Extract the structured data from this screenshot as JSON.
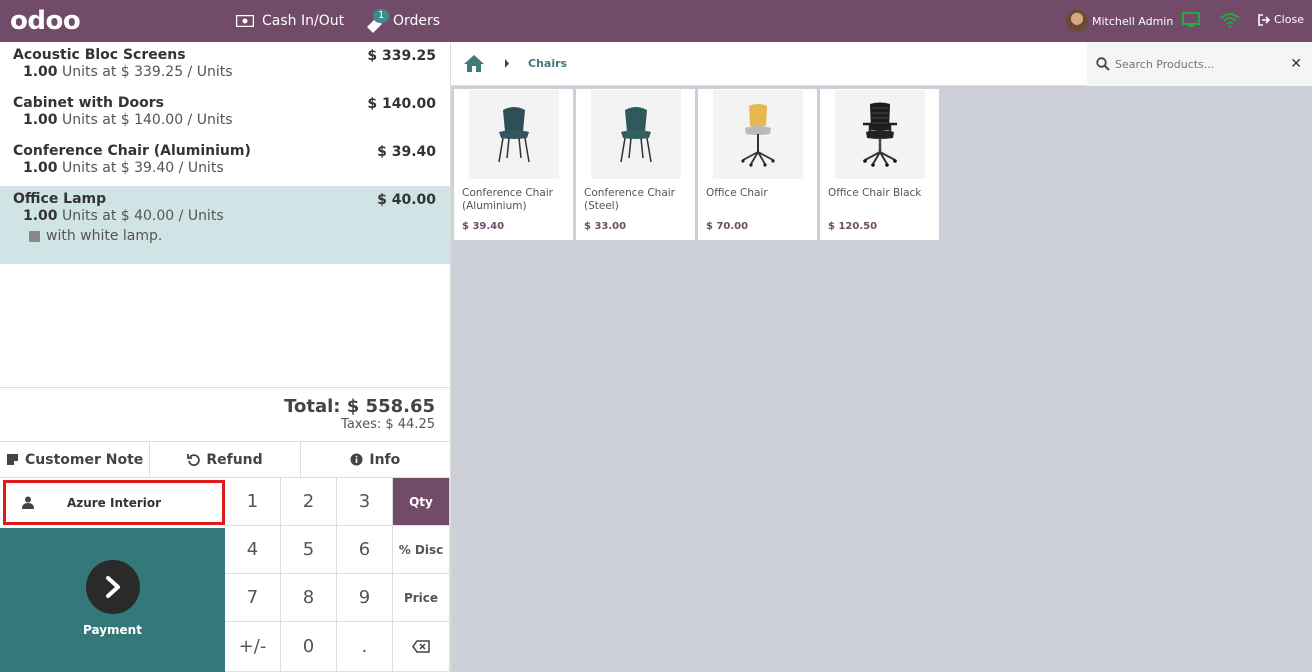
{
  "topbar": {
    "logo": "odoo",
    "cash_label": "Cash In/Out",
    "orders_label": "Orders",
    "orders_badge": "1",
    "user_name": "Mitchell Admin",
    "close_label": "Close"
  },
  "orderlines": [
    {
      "name": "Acoustic Bloc Screens",
      "price": "$ 339.25",
      "qty": "1.00",
      "info": "Units at $ 339.25 / Units"
    },
    {
      "name": "Cabinet with Doors",
      "price": "$ 140.00",
      "qty": "1.00",
      "info": "Units at $ 140.00 / Units"
    },
    {
      "name": "Conference Chair (Aluminium)",
      "price": "$ 39.40",
      "qty": "1.00",
      "info": "Units at $ 39.40 / Units"
    },
    {
      "name": "Office Lamp",
      "price": "$ 40.00",
      "qty": "1.00",
      "info": "Units at $ 40.00 / Units",
      "note": "with white lamp."
    }
  ],
  "totals": {
    "total": "Total: $ 558.65",
    "taxes": "Taxes: $ 44.25"
  },
  "controls": {
    "customer_note": "Customer Note",
    "refund": "Refund",
    "info": "Info"
  },
  "customer": {
    "name": "Azure Interior"
  },
  "payment": {
    "label": "Payment"
  },
  "numpad": {
    "keys": [
      "1",
      "2",
      "3",
      "Qty",
      "4",
      "5",
      "6",
      "% Disc",
      "7",
      "8",
      "9",
      "Price",
      "+/-",
      "0",
      "."
    ]
  },
  "breadcrumb": {
    "category": "Chairs"
  },
  "search": {
    "placeholder": "Search Products..."
  },
  "products": [
    {
      "name": "Conference Chair (Aluminium)",
      "price": "$ 39.40"
    },
    {
      "name": "Conference Chair (Steel)",
      "price": "$ 33.00"
    },
    {
      "name": "Office Chair",
      "price": "$ 70.00"
    },
    {
      "name": "Office Chair Black",
      "price": "$ 120.50"
    }
  ],
  "colors": {
    "brand": "#714b67",
    "payment": "#35787a",
    "selected_line": "#d1e4e5",
    "highlight_border": "#e01b1b"
  }
}
